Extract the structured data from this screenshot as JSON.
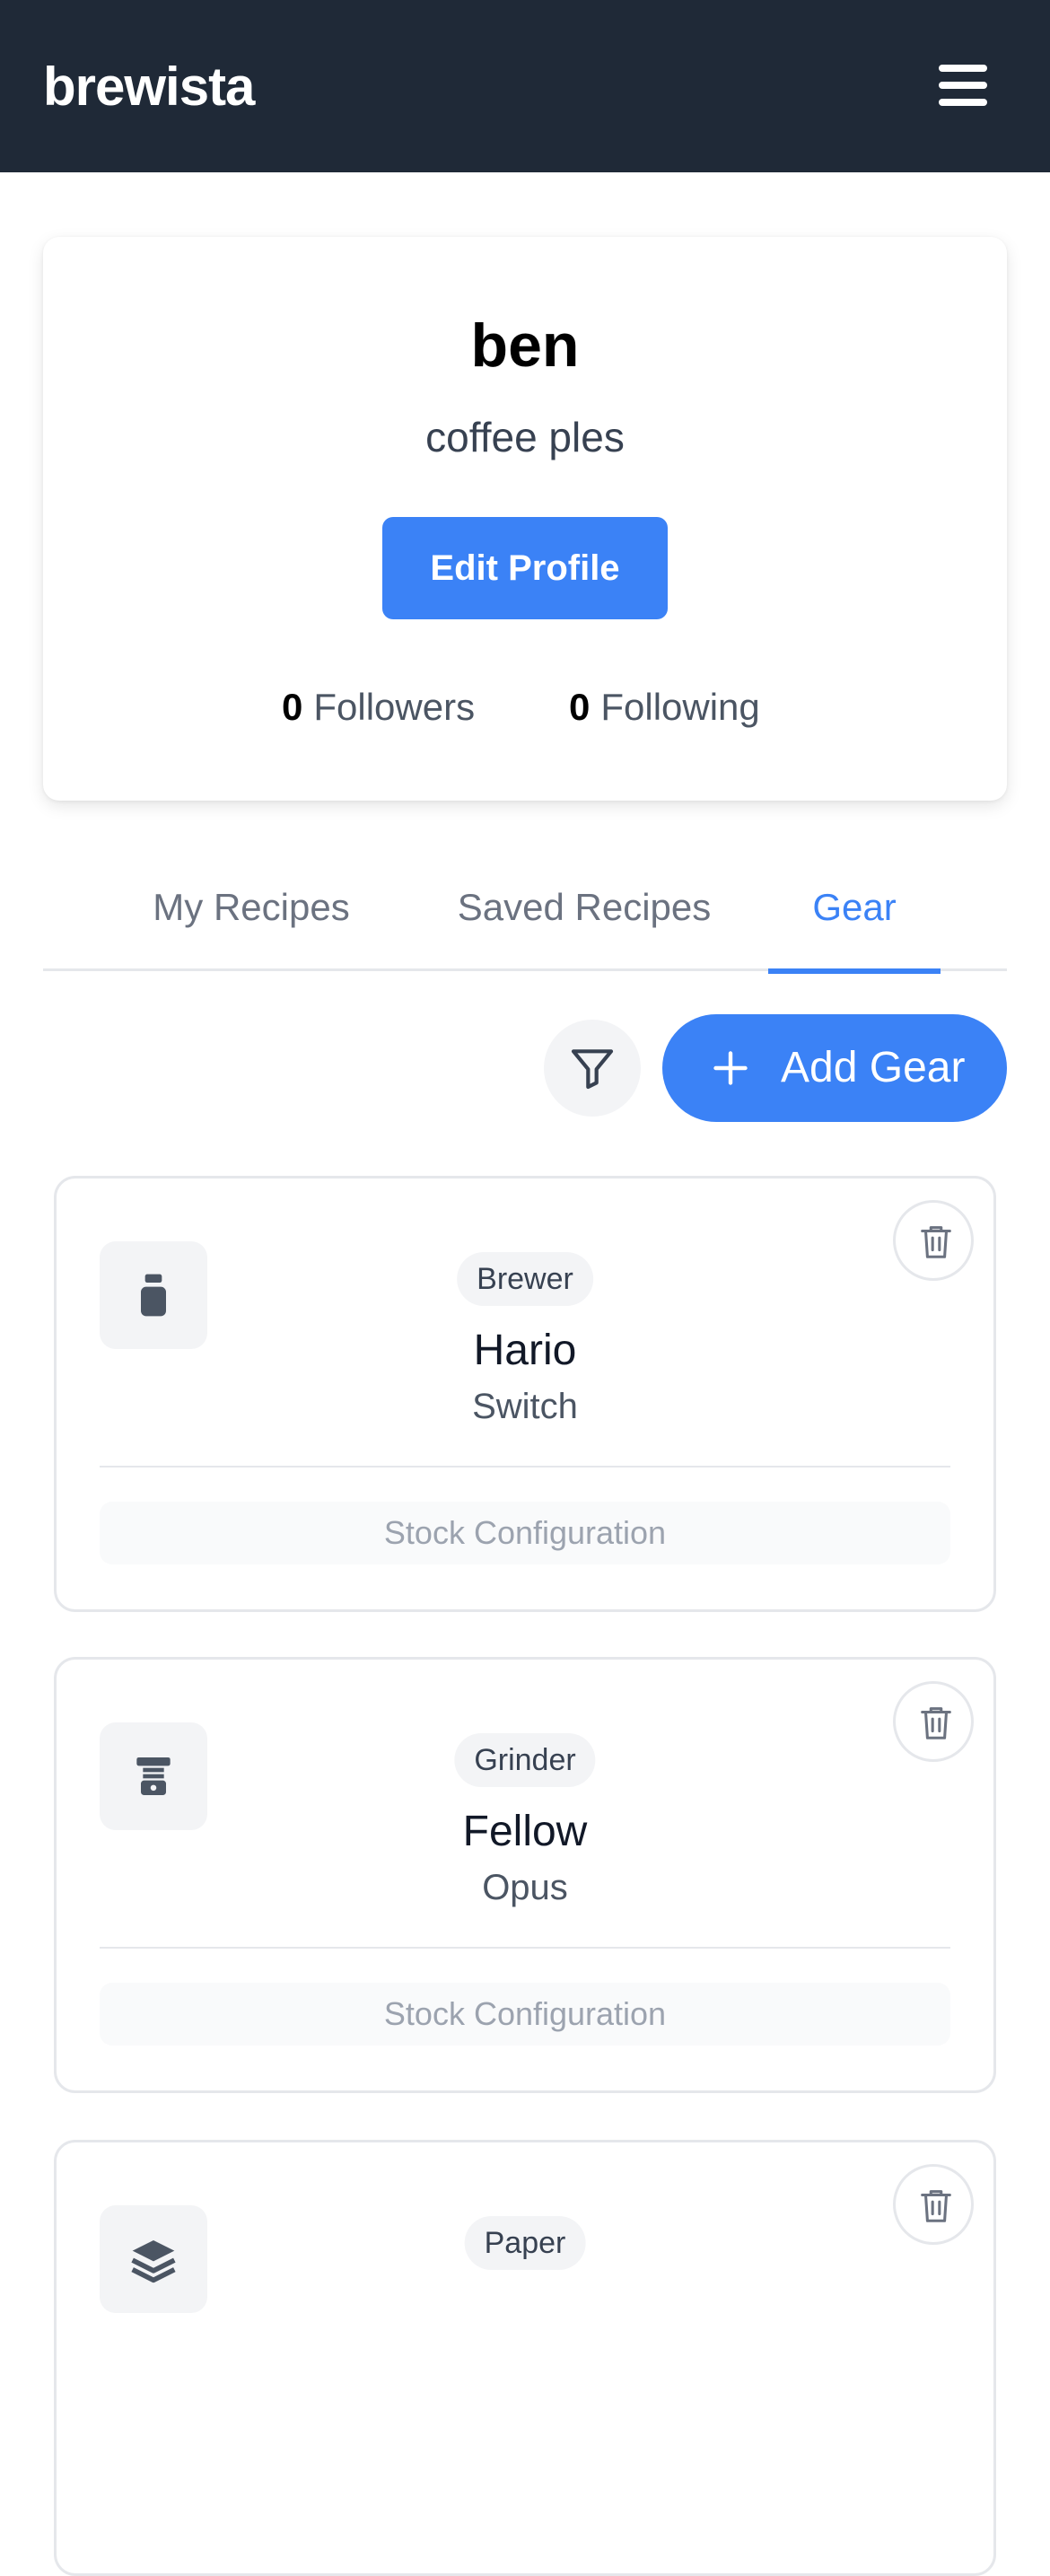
{
  "header": {
    "brand": "brewista",
    "menu_icon": "hamburger-menu-icon"
  },
  "profile": {
    "username": "ben",
    "bio": "coffee ples",
    "edit_label": "Edit Profile",
    "followers_count": "0",
    "followers_label": "Followers",
    "following_count": "0",
    "following_label": "Following"
  },
  "tabs": [
    {
      "label": "My Recipes",
      "active": false
    },
    {
      "label": "Saved Recipes",
      "active": false
    },
    {
      "label": "Gear",
      "active": true
    }
  ],
  "toolbar": {
    "filter_icon": "funnel-icon",
    "add_label": "Add Gear",
    "add_icon": "plus-icon"
  },
  "gear": [
    {
      "type": "Brewer",
      "brand": "Hario",
      "model": "Switch",
      "config": "Stock Configuration",
      "icon": "brewer-icon"
    },
    {
      "type": "Grinder",
      "brand": "Fellow",
      "model": "Opus",
      "config": "Stock Configuration",
      "icon": "grinder-icon"
    },
    {
      "type": "Paper",
      "brand": "",
      "model": "",
      "config": "",
      "icon": "layers-icon"
    }
  ],
  "colors": {
    "header_bg": "#1f2937",
    "accent": "#3b82f6",
    "chip_bg": "#f3f4f6",
    "border": "#e5e7eb"
  }
}
